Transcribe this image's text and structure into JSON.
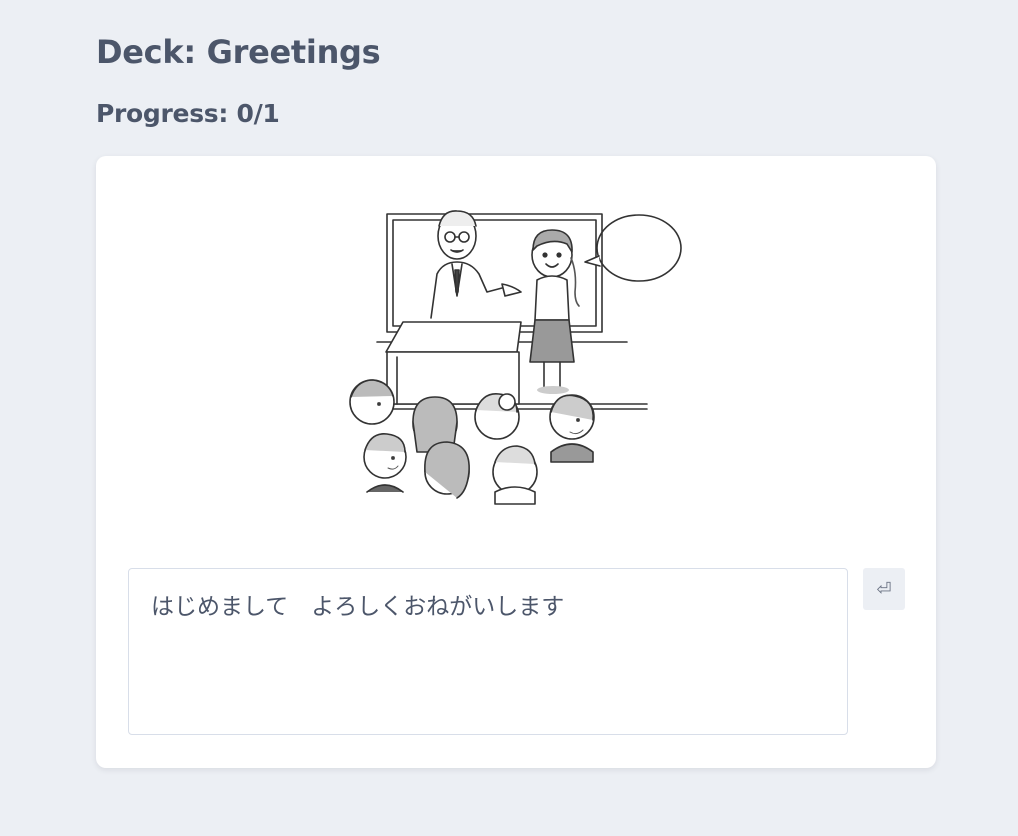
{
  "deck": {
    "title": "Deck: Greetings"
  },
  "progress": {
    "label": "Progress: 0/1",
    "completed": 0,
    "total": 1
  },
  "card": {
    "image_icon": "classroom-introduction-illustration",
    "answer_value": "はじめまして　よろしくおねがいします",
    "submit_icon": "return-icon",
    "submit_symbol": "⏎"
  },
  "colors": {
    "background": "#eceff4",
    "text": "#4c566a",
    "card": "#ffffff",
    "border": "#d8dee9"
  }
}
